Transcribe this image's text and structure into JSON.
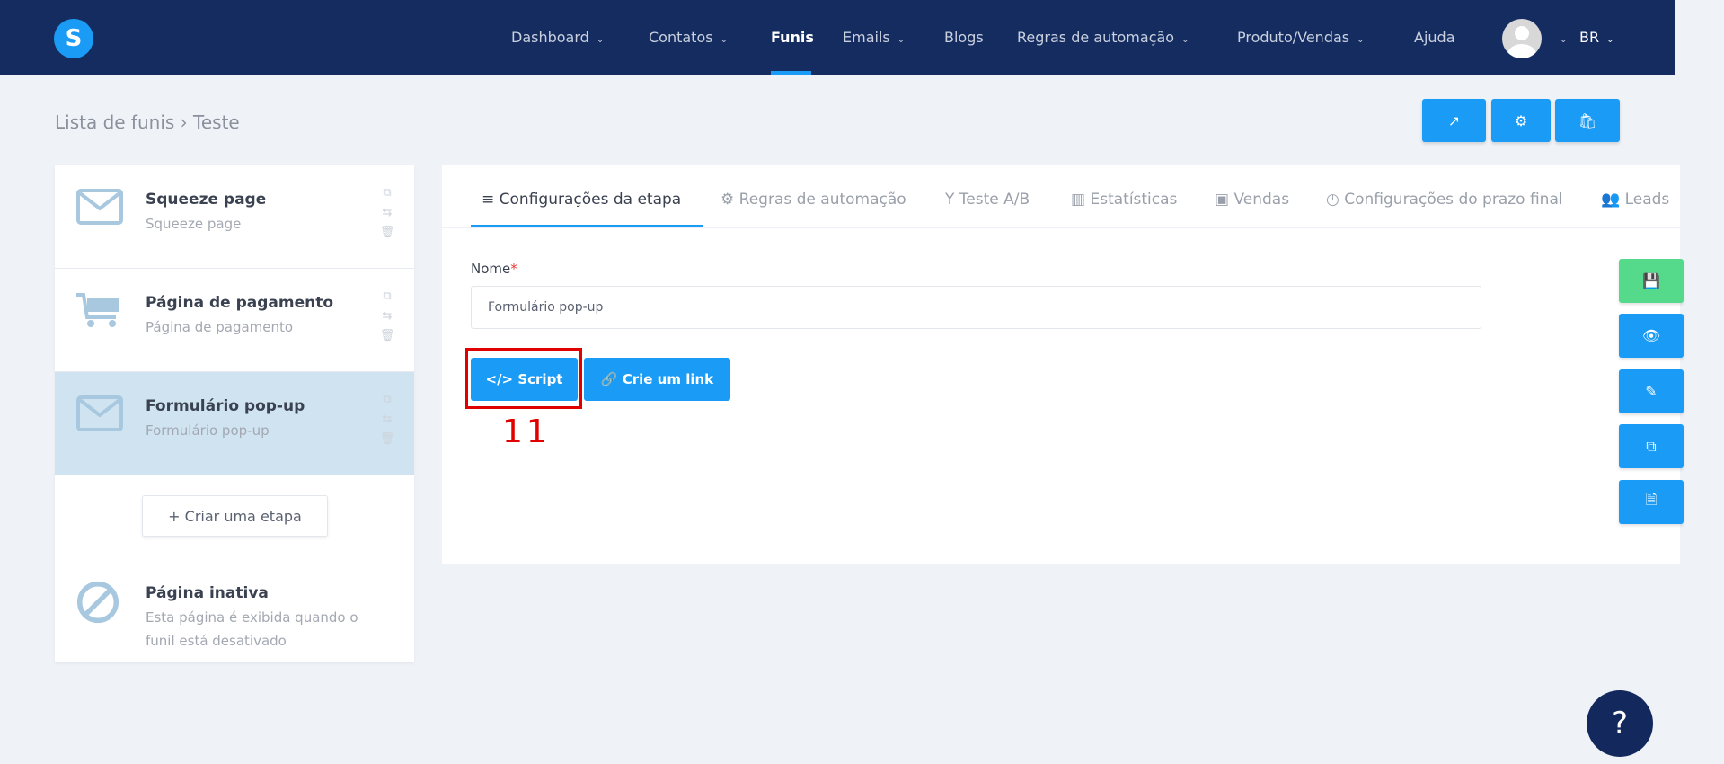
{
  "nav": {
    "logo": "S",
    "items": [
      {
        "label": "Dashboard",
        "chevron": true
      },
      {
        "label": "Contatos",
        "chevron": true
      },
      {
        "label": "Funis",
        "chevron": false,
        "active": true
      },
      {
        "label": "Emails",
        "chevron": true
      },
      {
        "label": "Blogs",
        "chevron": false
      },
      {
        "label": "Regras de automação",
        "chevron": true
      },
      {
        "label": "Produto/Vendas",
        "chevron": true
      },
      {
        "label": "Ajuda",
        "chevron": false
      }
    ],
    "lang": "BR"
  },
  "breadcrumb": {
    "root": "Lista de funis",
    "sep": "›",
    "current": "Teste"
  },
  "top_buttons": [
    "external-link-icon",
    "gear-icon",
    "shopping-bag-icon"
  ],
  "steps": [
    {
      "title": "Squeeze page",
      "subtitle": "Squeeze page",
      "icon": "envelope-icon"
    },
    {
      "title": "Página de pagamento",
      "subtitle": "Página de pagamento",
      "icon": "cart-icon"
    },
    {
      "title": "Formulário pop-up",
      "subtitle": "Formulário pop-up",
      "icon": "envelope-icon",
      "selected": true
    }
  ],
  "create_step": "+ Criar uma etapa",
  "inactive": {
    "title": "Página inativa",
    "subtitle": "Esta página é exibida quando o",
    "subtitle2": "funil está desativado"
  },
  "tabs": [
    {
      "icon": "≡",
      "label": "Configurações da etapa"
    },
    {
      "icon": "⚙",
      "label": "Regras de automação"
    },
    {
      "icon": "Y",
      "label": "Teste A/B"
    },
    {
      "icon": "▥",
      "label": "Estatísticas"
    },
    {
      "icon": "▣",
      "label": "Vendas"
    },
    {
      "icon": "◷",
      "label": "Configurações do prazo final"
    },
    {
      "icon": "👥",
      "label": "Leads"
    }
  ],
  "form": {
    "name_label": "Nome",
    "required": "*",
    "name_value": "Formulário pop-up"
  },
  "buttons": {
    "script": "</> Script",
    "link": "🔗 Crie um link"
  },
  "annotation": "11",
  "side_buttons": [
    "save-icon",
    "eye-icon",
    "magic-icon",
    "copy-icon",
    "file-icon"
  ],
  "help": "?",
  "colors": {
    "navy": "#142c60",
    "blue": "#1a9bf5",
    "green": "#55d98b",
    "selected": "#cfe3f1"
  }
}
